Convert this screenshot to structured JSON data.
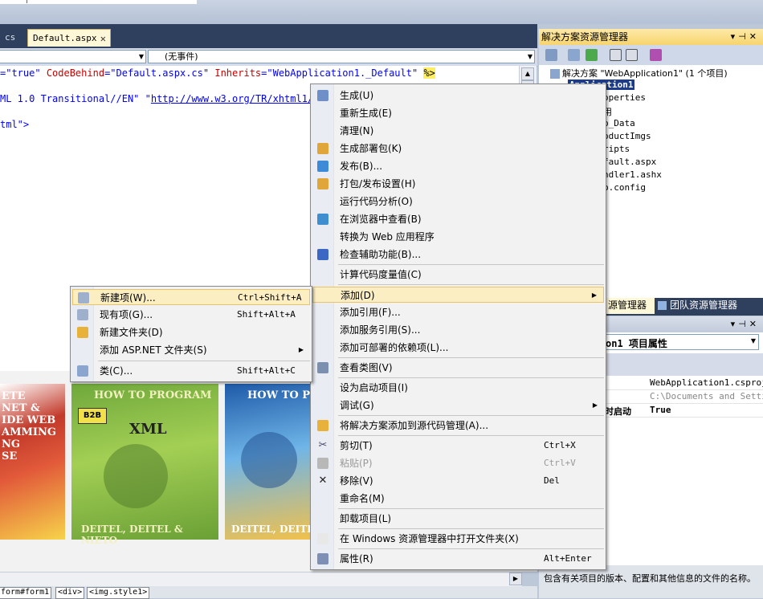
{
  "editor": {
    "tabs": [
      {
        "label": "cs"
      },
      {
        "label": "Default.aspx"
      }
    ],
    "dropdown_right": "(无事件)",
    "lines": {
      "line1": {
        "a": "=\"true\"",
        "b": "CodeBehind",
        "c": "=\"Default.aspx.cs\"",
        "d": "Inherits",
        "e": "=\"WebApplication1._Default\"",
        "f": "%>"
      },
      "line2": {
        "a": "ML 1.0 Transitional//EN\"",
        "b": "\"",
        "c": "http://www.w3.org/TR/xhtml1/D"
      },
      "line3": {
        "a": "tml\">"
      }
    }
  },
  "design": {
    "book1": {
      "lines": [
        "ETE",
        "NET &",
        "IDE WEB",
        "AMMING",
        "NG",
        "SE"
      ]
    },
    "book2": {
      "title": "HOW TO PROGRAM",
      "xml": "XML",
      "badge": "B2B",
      "authors": "DEITEL, DEITEL & NIETO"
    },
    "book3": {
      "title": "HOW TO PRO",
      "authors": "DEITEL, DEITE"
    }
  },
  "status": {
    "crumbs": [
      "form#form1",
      "<div>",
      "<img.style1>"
    ]
  },
  "solution_explorer": {
    "title": "解决方案资源管理器",
    "solution_row": "解决方案 \"WebApplication1\" (1 个项目)",
    "project_row": "Application1",
    "items": [
      "operties",
      "用",
      "p_Data",
      "oductImgs",
      "ripts",
      "fault.aspx",
      "ndler1.ashx",
      "b.config"
    ]
  },
  "panel_tabs": {
    "left": "源管理器",
    "right": "团队资源管理器"
  },
  "properties": {
    "object": "on1 项目属性",
    "rows": [
      {
        "name": "",
        "value": "WebApplication1.csproj"
      },
      {
        "name": "",
        "value": "C:\\Documents and Settin"
      },
      {
        "name": "时启动",
        "value": "True"
      }
    ],
    "description": "包含有关项目的版本、配置和其他信息的文件的名称。"
  },
  "main_menu": {
    "items": [
      {
        "label": "生成(U)",
        "shortcut": "",
        "icon": "build-icon"
      },
      {
        "label": "重新生成(E)",
        "shortcut": "",
        "icon": ""
      },
      {
        "label": "清理(N)",
        "shortcut": "",
        "icon": ""
      },
      {
        "label": "生成部署包(K)",
        "shortcut": "",
        "icon": "package-icon"
      },
      {
        "label": "发布(B)...",
        "shortcut": "",
        "icon": "publish-icon"
      },
      {
        "label": "打包/发布设置(H)",
        "shortcut": "",
        "icon": "settings-icon"
      },
      {
        "label": "运行代码分析(O)",
        "shortcut": "",
        "icon": ""
      },
      {
        "label": "在浏览器中查看(B)",
        "shortcut": "",
        "icon": "browser-icon"
      },
      {
        "label": "转换为 Web 应用程序",
        "shortcut": "",
        "icon": ""
      },
      {
        "label": "检查辅助功能(B)...",
        "shortcut": "",
        "icon": "accessibility-icon"
      },
      {
        "label": "计算代码度量值(C)",
        "shortcut": "",
        "icon": ""
      },
      {
        "label": "添加(D)",
        "shortcut": "",
        "icon": ""
      },
      {
        "label": "添加引用(F)...",
        "shortcut": "",
        "icon": ""
      },
      {
        "label": "添加服务引用(S)...",
        "shortcut": "",
        "icon": ""
      },
      {
        "label": "添加可部署的依赖项(L)...",
        "shortcut": "",
        "icon": ""
      },
      {
        "label": "查看类图(V)",
        "shortcut": "",
        "icon": "class-diagram-icon"
      },
      {
        "label": "设为启动项目(I)",
        "shortcut": "",
        "icon": ""
      },
      {
        "label": "调试(G)",
        "shortcut": "",
        "icon": ""
      },
      {
        "label": "将解决方案添加到源代码管理(A)...",
        "shortcut": "",
        "icon": "source-control-icon"
      },
      {
        "label": "剪切(T)",
        "shortcut": "Ctrl+X",
        "icon": "cut-icon"
      },
      {
        "label": "粘贴(P)",
        "shortcut": "Ctrl+V",
        "icon": "paste-icon"
      },
      {
        "label": "移除(V)",
        "shortcut": "Del",
        "icon": "remove-icon"
      },
      {
        "label": "重命名(M)",
        "shortcut": "",
        "icon": ""
      },
      {
        "label": "卸载项目(L)",
        "shortcut": "",
        "icon": ""
      },
      {
        "label": "在 Windows 资源管理器中打开文件夹(X)",
        "shortcut": "",
        "icon": "folder-open-icon"
      },
      {
        "label": "属性(R)",
        "shortcut": "Alt+Enter",
        "icon": "properties-icon"
      }
    ]
  },
  "sub_menu": {
    "items": [
      {
        "label": "新建项(W)...",
        "shortcut": "Ctrl+Shift+A",
        "icon": "new-item-icon"
      },
      {
        "label": "现有项(G)...",
        "shortcut": "Shift+Alt+A",
        "icon": "existing-item-icon"
      },
      {
        "label": "新建文件夹(D)",
        "shortcut": "",
        "icon": "new-folder-icon"
      },
      {
        "label": "添加 ASP.NET 文件夹(S)",
        "shortcut": "",
        "icon": ""
      },
      {
        "label": "类(C)...",
        "shortcut": "Shift+Alt+C",
        "icon": "class-icon"
      }
    ]
  }
}
